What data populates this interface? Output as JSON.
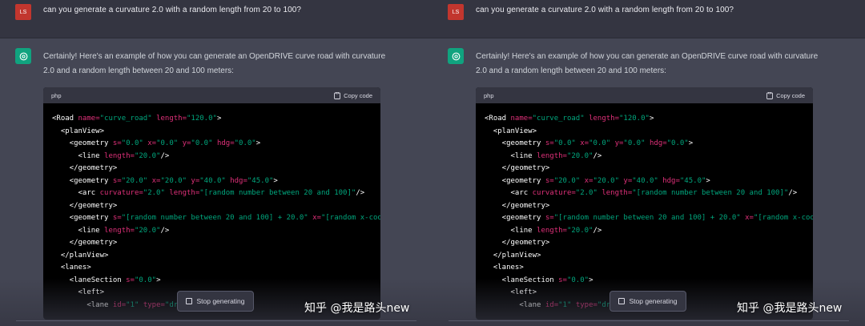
{
  "user": {
    "avatar_initials": "LS",
    "message": "can you generate a curvature 2.0 with a random length from 20 to 100?"
  },
  "assistant": {
    "message": "Certainly! Here's an example of how you can generate an OpenDRIVE curve road with curvature 2.0 and a random length between 20 and 100 meters:",
    "code_language": "php",
    "copy_label": "Copy code",
    "stop_label": "Stop generating"
  },
  "watermark": "知乎 @我是路头new",
  "code_lines": [
    [
      {
        "t": "tag",
        "v": "<Road "
      },
      {
        "t": "attr",
        "v": "name="
      },
      {
        "t": "val",
        "v": "\"curve_road\""
      },
      {
        "t": "tag",
        "v": " "
      },
      {
        "t": "attr",
        "v": "length="
      },
      {
        "t": "val",
        "v": "\"120.0\""
      },
      {
        "t": "tag",
        "v": ">"
      }
    ],
    [
      {
        "t": "tag",
        "v": "  <planView>"
      }
    ],
    [
      {
        "t": "tag",
        "v": "    <geometry "
      },
      {
        "t": "attr",
        "v": "s="
      },
      {
        "t": "val",
        "v": "\"0.0\""
      },
      {
        "t": "tag",
        "v": " "
      },
      {
        "t": "attr",
        "v": "x="
      },
      {
        "t": "val",
        "v": "\"0.0\""
      },
      {
        "t": "tag",
        "v": " "
      },
      {
        "t": "attr",
        "v": "y="
      },
      {
        "t": "val",
        "v": "\"0.0\""
      },
      {
        "t": "tag",
        "v": " "
      },
      {
        "t": "attr",
        "v": "hdg="
      },
      {
        "t": "val",
        "v": "\"0.0\""
      },
      {
        "t": "tag",
        "v": ">"
      }
    ],
    [
      {
        "t": "tag",
        "v": "      <line "
      },
      {
        "t": "attr",
        "v": "length="
      },
      {
        "t": "val",
        "v": "\"20.0\""
      },
      {
        "t": "tag",
        "v": "/>"
      }
    ],
    [
      {
        "t": "tag",
        "v": "    </geometry>"
      }
    ],
    [
      {
        "t": "tag",
        "v": "    <geometry "
      },
      {
        "t": "attr",
        "v": "s="
      },
      {
        "t": "val",
        "v": "\"20.0\""
      },
      {
        "t": "tag",
        "v": " "
      },
      {
        "t": "attr",
        "v": "x="
      },
      {
        "t": "val",
        "v": "\"20.0\""
      },
      {
        "t": "tag",
        "v": " "
      },
      {
        "t": "attr",
        "v": "y="
      },
      {
        "t": "val",
        "v": "\"40.0\""
      },
      {
        "t": "tag",
        "v": " "
      },
      {
        "t": "attr",
        "v": "hdg="
      },
      {
        "t": "val",
        "v": "\"45.0\""
      },
      {
        "t": "tag",
        "v": ">"
      }
    ],
    [
      {
        "t": "tag",
        "v": "      <arc "
      },
      {
        "t": "attr",
        "v": "curvature="
      },
      {
        "t": "val",
        "v": "\"2.0\""
      },
      {
        "t": "tag",
        "v": " "
      },
      {
        "t": "attr",
        "v": "length="
      },
      {
        "t": "val",
        "v": "\"[random number between 20 and 100]\""
      },
      {
        "t": "tag",
        "v": "/>"
      }
    ],
    [
      {
        "t": "tag",
        "v": "    </geometry>"
      }
    ],
    [
      {
        "t": "tag",
        "v": "    <geometry "
      },
      {
        "t": "attr",
        "v": "s="
      },
      {
        "t": "val",
        "v": "\"[random number between 20 and 100] + 20.0\""
      },
      {
        "t": "tag",
        "v": " "
      },
      {
        "t": "attr",
        "v": "x="
      },
      {
        "t": "val",
        "v": "\"[random x-coo"
      }
    ],
    [
      {
        "t": "tag",
        "v": "      <line "
      },
      {
        "t": "attr",
        "v": "length="
      },
      {
        "t": "val",
        "v": "\"20.0\""
      },
      {
        "t": "tag",
        "v": "/>"
      }
    ],
    [
      {
        "t": "tag",
        "v": "    </geometry>"
      }
    ],
    [
      {
        "t": "tag",
        "v": "  </planView>"
      }
    ],
    [
      {
        "t": "tag",
        "v": "  <lanes>"
      }
    ],
    [
      {
        "t": "tag",
        "v": "    <laneSection "
      },
      {
        "t": "attr",
        "v": "s="
      },
      {
        "t": "val",
        "v": "\"0.0\""
      },
      {
        "t": "tag",
        "v": ">"
      }
    ],
    [
      {
        "t": "tag",
        "v": "      <left>"
      }
    ],
    [
      {
        "t": "tag",
        "v": "        <lane "
      },
      {
        "t": "attr",
        "v": "id="
      },
      {
        "t": "val",
        "v": "\"1\""
      },
      {
        "t": "tag",
        "v": " "
      },
      {
        "t": "attr",
        "v": "type="
      },
      {
        "t": "val",
        "v": "\"dr"
      }
    ]
  ]
}
